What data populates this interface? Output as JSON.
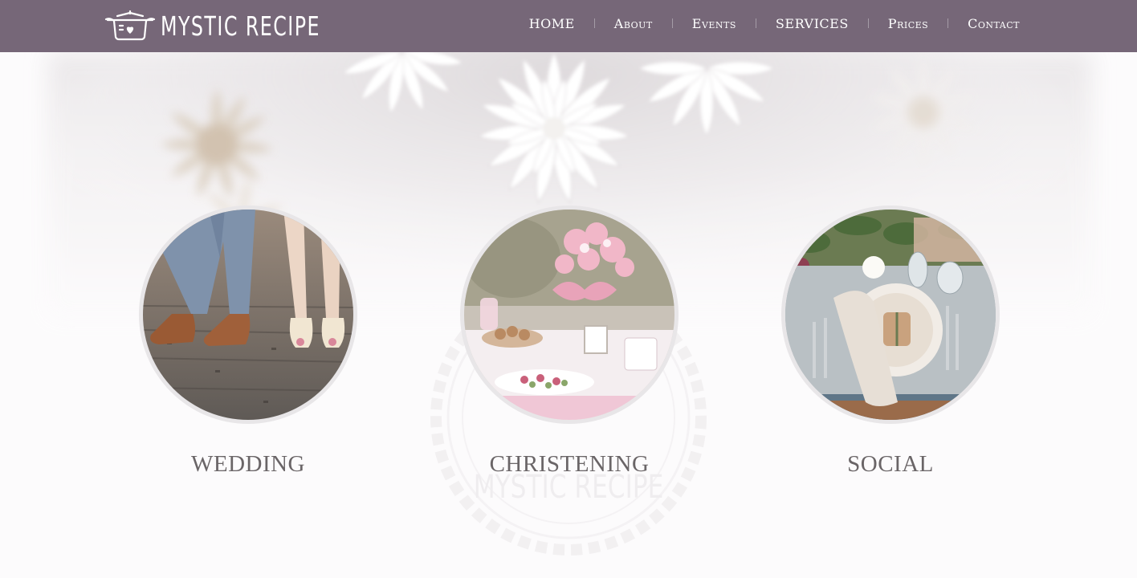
{
  "brand": {
    "name": "MYSTIC RECIPE",
    "logo_icon": "cooking-pot-icon",
    "watermark_text": "MYSTIC RECIPE"
  },
  "nav": {
    "items": [
      {
        "label": "HOME"
      },
      {
        "label": "About"
      },
      {
        "label": "Events"
      },
      {
        "label": "SERVICES"
      },
      {
        "label": "Prices"
      },
      {
        "label": "Contact"
      }
    ]
  },
  "categories": [
    {
      "title": "WEDDING",
      "image": "wedding-shoes-photo"
    },
    {
      "title": "CHRISTENING",
      "image": "christening-dessert-table-photo"
    },
    {
      "title": "SOCIAL",
      "image": "table-setting-photo"
    }
  ],
  "colors": {
    "header_bg": "#766778",
    "nav_text": "#ffffff",
    "title_text": "#6a6567",
    "page_bg": "#fcfbfc"
  }
}
